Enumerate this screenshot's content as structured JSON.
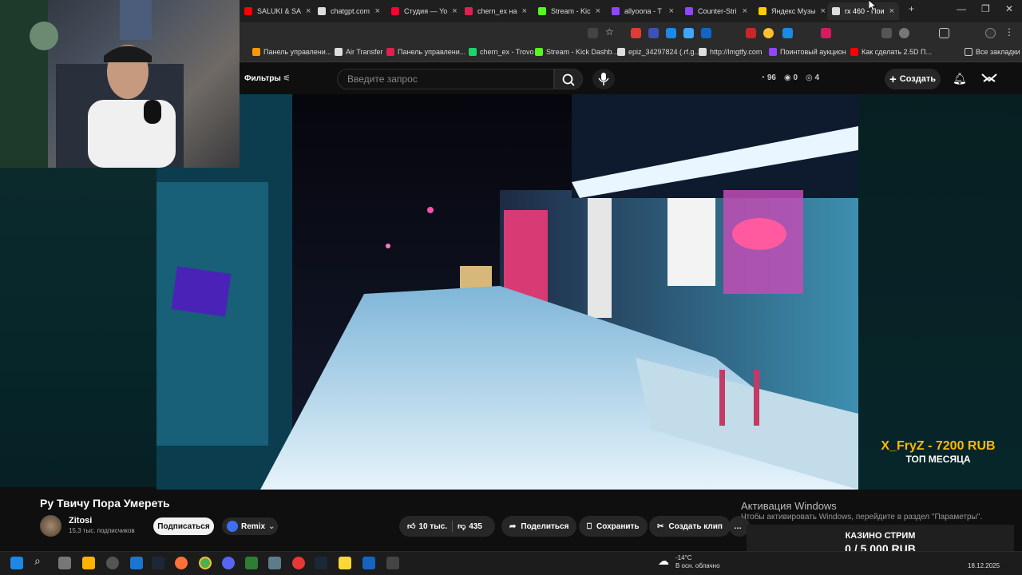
{
  "browser": {
    "tabs": [
      {
        "label": "SALUKI & SA",
        "color": "#ff0000"
      },
      {
        "label": "chatgpt.com",
        "color": "#dddddd"
      },
      {
        "label": "Студия — Yo",
        "color": "#ff0033"
      },
      {
        "label": "chern_ex на",
        "color": "#e02050"
      },
      {
        "label": "Stream - Kic",
        "color": "#53fc18"
      },
      {
        "label": "allyoona - T",
        "color": "#9146ff"
      },
      {
        "label": "Counter-Stri",
        "color": "#9146ff"
      },
      {
        "label": "Яндекс Музы",
        "color": "#ffcc00"
      },
      {
        "label": "rx 460 - Пои",
        "color": "#dddddd"
      }
    ],
    "new_tab": "+",
    "window_controls": [
      "—",
      "❐",
      "✕"
    ],
    "bookmarks": [
      {
        "label": "Панель управлени...",
        "color": "#ff9800"
      },
      {
        "label": "Air Transfer",
        "color": "#dddddd"
      },
      {
        "label": "Панель управлени...",
        "color": "#e02050"
      },
      {
        "label": "chern_ex - Trovo",
        "color": "#19d66b"
      },
      {
        "label": "Stream - Kick Dashb...",
        "color": "#53fc18"
      },
      {
        "label": "epiz_34297824 (.rf.g...",
        "color": "#dddddd"
      },
      {
        "label": "http://lmgtfy.com",
        "color": "#dddddd"
      },
      {
        "label": "Поинтовый аукцион",
        "color": "#9146ff"
      },
      {
        "label": "Как сделать 2.5D П...",
        "color": "#ff0000"
      }
    ],
    "bookmarks_more": "»",
    "all_bookmarks": "Все закладки"
  },
  "youtube": {
    "filters_label": "Фильтры",
    "search_placeholder": "Введите запрос",
    "stats": {
      "views": "96",
      "eye": "0",
      "hidden": "4"
    },
    "create_label": "Создать",
    "video_title": "Ру Твичу Пора Умереть",
    "channel_name": "Zitosi",
    "channel_subs": "15,3 тыс. подписчиков",
    "subscribe_label": "Подписаться",
    "remix_label": "Remix",
    "likes": "10 тыс.",
    "dislikes": "435",
    "share_label": "Поделиться",
    "save_label": "Сохранить",
    "clip_label": "Создать клип",
    "more_label": "…"
  },
  "overlay": {
    "top_donor": "X_FryZ - 7200 RUB",
    "top_donor_sub": "ТОП МЕСЯЦА",
    "casino_title": "КАЗИНО СТРИМ",
    "casino_progress": "0 / 5 000 RUB",
    "activation_title": "Активация Windows",
    "activation_text": "Чтобы активировать Windows, перейдите в раздел \"Параметры\"."
  },
  "taskbar": {
    "weather_temp": "-14°C",
    "weather_desc": "В осн. облачно",
    "date": "18.12.2025"
  },
  "colors": {
    "donor": "#ffb800",
    "accent": "#ff0000"
  }
}
